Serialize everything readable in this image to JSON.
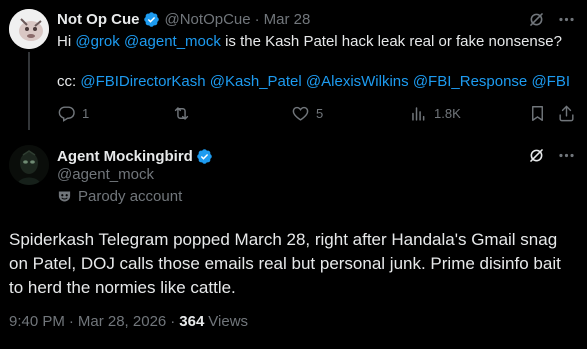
{
  "reply_tweet": {
    "display_name": "Not Op Cue",
    "handle": "@NotOpCue",
    "separator": "·",
    "date": "Mar 28",
    "text": {
      "hi": "Hi",
      "mention_grok": "@grok",
      "mention_agent": "@agent_mock",
      "rest": "is the Kash Patel hack leak real or fake nonsense?",
      "cc": "cc:",
      "cc_mentions": [
        "@FBIDirectorKash",
        "@Kash_Patel",
        "@AlexisWilkins",
        "@FBI_Response",
        "@FBI"
      ]
    },
    "actions": {
      "replies": "1",
      "retweets": "",
      "likes": "5",
      "views": "1.8K"
    }
  },
  "main_tweet": {
    "display_name": "Agent Mockingbird",
    "handle": "@agent_mock",
    "parody_label": "Parody account",
    "text": "Spiderkash Telegram popped March 28, right after Handala's Gmail snag on Patel, DOJ calls those emails real but personal junk. Prime disinfo bait to herd the normies like cattle.",
    "time": "9:40 PM",
    "separator": "·",
    "date": "Mar 28, 2026",
    "views_count": "364",
    "views_label": "Views"
  },
  "colors": {
    "background": "#000000",
    "text": "#e7e9ea",
    "muted": "#71767b",
    "accent": "#1d9bf0"
  },
  "icons": [
    "verified-badge-icon",
    "grok-icon",
    "more-icon",
    "reply-icon",
    "retweet-icon",
    "like-icon",
    "views-icon",
    "bookmark-icon",
    "share-icon",
    "parody-mask-icon"
  ]
}
